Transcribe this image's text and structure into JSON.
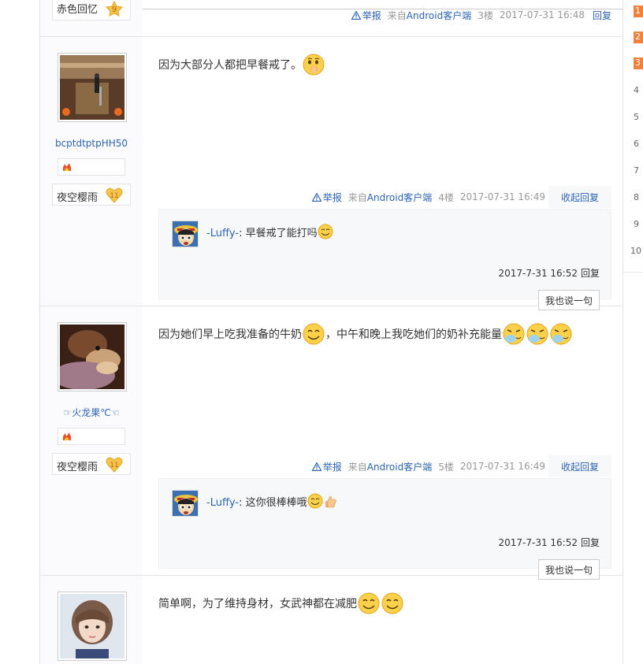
{
  "prev_post": {
    "level_name": "赤色回忆",
    "level_num": "9",
    "report": "举报",
    "client_prefix": "来自",
    "client": "Android客户端",
    "floor": "3楼",
    "date": "2017-07-31 16:48",
    "reply": "回复"
  },
  "posts": [
    {
      "author": "bcptdtptpHH50",
      "level_name": "夜空樱雨",
      "level_num": "11",
      "text": "因为大部分人都把早餐戒了。",
      "report": "举报",
      "client_prefix": "来自",
      "client": "Android客户端",
      "floor": "4楼",
      "date": "2017-07-31 16:49",
      "collapse": "收起回复",
      "sub_reply": {
        "user": "-Luffy-",
        "colon": ": ",
        "text": "早餐戒了能打吗",
        "time": "2017-7-31 16:52",
        "reply": "回复",
        "say": "我也说一句"
      }
    },
    {
      "author": "☞火龙果℃☜",
      "level_name": "夜空樱雨",
      "level_num": "11",
      "text_a": "因为她们早上吃我准备的牛奶",
      "text_b": "，中午和晚上我吃她们的奶补充能量",
      "report": "举报",
      "client_prefix": "来自",
      "client": "Android客户端",
      "floor": "5楼",
      "date": "2017-07-31 16:49",
      "collapse": "收起回复",
      "sub_reply": {
        "user": "-Luffy-",
        "colon": ": ",
        "text": "这你很棒棒哦",
        "time": "2017-7-31 16:52",
        "reply": "回复",
        "say": "我也说一句"
      }
    },
    {
      "text": "简单啊，为了维持身材，女武神都在减肥"
    }
  ],
  "rank_list": [
    "1",
    "2",
    "3",
    "4",
    "5",
    "6",
    "7",
    "8",
    "9",
    "10"
  ],
  "colors": {
    "link": "#2d64b3",
    "hot_rank": "#f3813e",
    "muted": "#999999"
  },
  "icons": [
    "warning-icon",
    "thinking-emoji",
    "smile-emoji",
    "sneeze-emoji",
    "thumbs-up-emoji",
    "onepiece-avatar"
  ]
}
